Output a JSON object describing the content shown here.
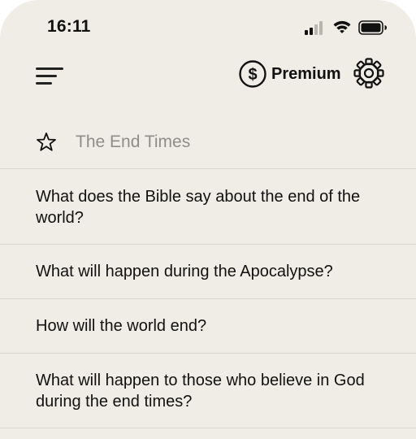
{
  "status_bar": {
    "time": "16:11",
    "signal_icon": "cellular-signal-icon",
    "wifi_icon": "wifi-icon",
    "battery_icon": "battery-icon"
  },
  "header": {
    "menu_icon": "menu-icon",
    "premium_icon": "dollar-coin-icon",
    "premium_label": "Premium",
    "settings_icon": "gear-icon"
  },
  "section": {
    "icon": "star-outline-icon",
    "title": "The End Times"
  },
  "questions": [
    "What does the Bible say about the end of the world?",
    "What will happen during the Apocalypse?",
    "How will the world end?",
    "What will happen to those who believe in God during the end times?"
  ],
  "colors": {
    "background": "#f0ede6",
    "text": "#111111",
    "muted_text": "#8f8d89",
    "divider": "#dad6cf"
  }
}
